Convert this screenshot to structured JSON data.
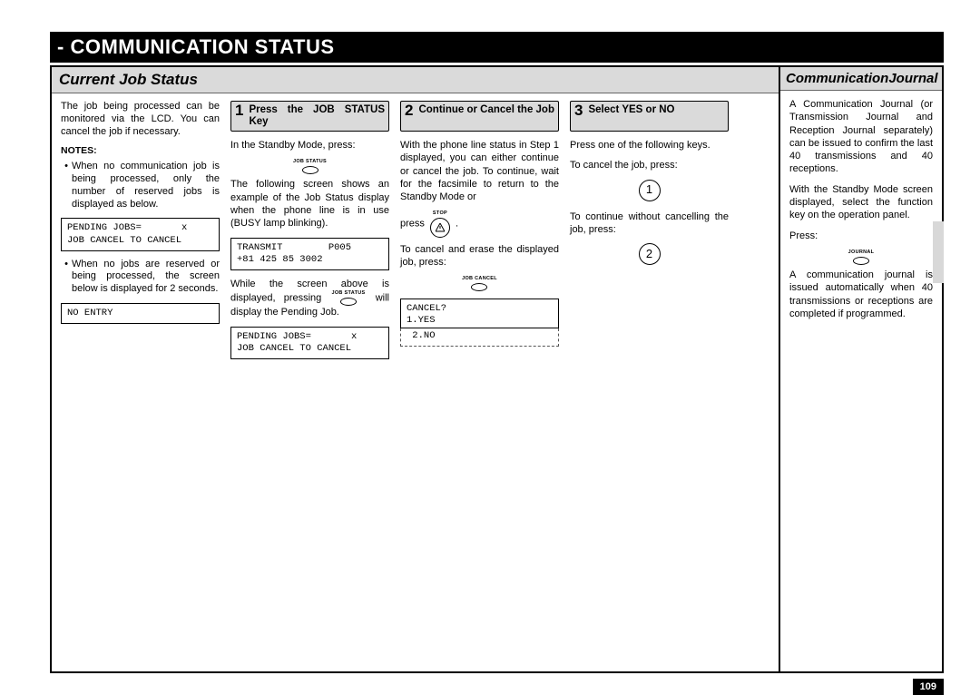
{
  "header": {
    "title": "- COMMUNICATION STATUS"
  },
  "sectionLeft": {
    "title": "Current Job Status"
  },
  "sectionRight": {
    "title_a": "Communication",
    "title_b": "Journal"
  },
  "intro": {
    "para": "The job being processed can be monitored via the LCD. You can cancel the job if necessary.",
    "notes_h": "NOTES:",
    "note1": "When no communication job is being processed, only the number of reserved jobs is displayed as below.",
    "lcd1": "PENDING JOBS=       x\nJOB CANCEL TO CANCEL",
    "note2": "When no jobs are reserved or being processed, the screen below is displayed for 2 seconds.",
    "lcd2": "NO ENTRY"
  },
  "step1": {
    "num": "1",
    "title": "Press the JOB STATUS Key",
    "p1": "In the Standby Mode, press:",
    "key1": "JOB STATUS",
    "p2": "The following screen shows an example of the Job Status display when the phone line is in use (BUSY lamp blinking).",
    "lcd": "TRANSMIT        P005\n+81 425 85 3002",
    "p3a": "While the screen above is displayed, pressing",
    "p3b": "will display the Pending Job.",
    "key2": "JOB STATUS",
    "lcd2": "PENDING JOBS=       x\nJOB CANCEL TO CANCEL"
  },
  "step2": {
    "num": "2",
    "title": "Continue or Cancel the Job",
    "p1": "With the phone line status in Step 1 displayed, you can either continue or cancel the job. To continue, wait for the facsimile to return to the Standby Mode or",
    "p1_press": "press",
    "key_stop": "STOP",
    "p2": "To cancel and erase the displayed job, press:",
    "key_jc": "JOB CANCEL",
    "lcd_top": "CANCEL?\n1.YES",
    "lcd_bottom": " 2.NO"
  },
  "step3": {
    "num": "3",
    "title": "Select YES or NO",
    "p1": "Press one of the following keys.",
    "p2": "To cancel the job, press:",
    "btn1": "1",
    "p3": "To continue without cancelling the job, press:",
    "btn2": "2"
  },
  "right": {
    "p1": "A Communication Journal (or Transmission Journal and Reception Journal separately) can be issued to confirm the last 40 transmissions and 40 receptions.",
    "p2": "With the Standby Mode screen displayed, select the function key on the operation panel.",
    "p3": "Press:",
    "key": "JOURNAL",
    "p4": "A communication journal is issued automatically when 40 transmissions or receptions are completed if programmed."
  },
  "page": "109"
}
